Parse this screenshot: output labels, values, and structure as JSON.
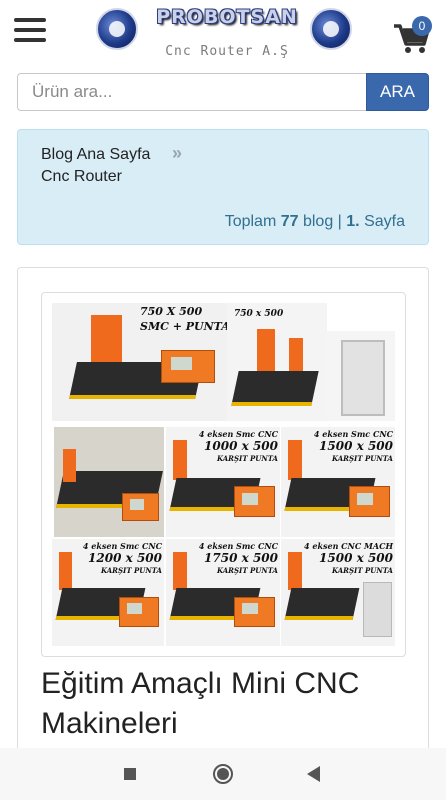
{
  "header": {
    "logo_title": "PROBOTSAN",
    "logo_subtitle": "Cnc Router A.Ş",
    "cart_count": "0"
  },
  "search": {
    "placeholder": "Ürün ara...",
    "button_label": "ARA"
  },
  "breadcrumb": {
    "home_label": "Blog Ana Sayfa",
    "separator": "»",
    "current_label": "Cnc Router",
    "total_prefix": "Toplam",
    "total_count": "77",
    "total_suffix": "blog",
    "divider": "|",
    "page_number": "1.",
    "page_label": "Sayfa"
  },
  "post": {
    "title": "Eğitim Amaçlı Mini CNC Makineleri",
    "image_labels": {
      "main_size": "750 X 500",
      "main_sub": "SMC + PUNTA",
      "side_size": "750 x 500",
      "t1_top": "4 eksen Smc CNC",
      "t1_size": "1000 x 500",
      "t1_sub": "KARŞIT PUNTA",
      "t2_top": "4 eksen Smc CNC",
      "t2_size": "1500 x 500",
      "t2_sub": "KARŞIT PUNTA",
      "t3_top": "4 eksen Smc CNC",
      "t3_size": "1200 x 500",
      "t3_sub": "KARŞIT PUNTA",
      "t4_top": "4 eksen Smc CNC",
      "t4_size": "1750 x 500",
      "t4_sub": "KARŞIT PUNTA",
      "t5_top": "4 eksen CNC MACH",
      "t5_size": "1500 x 500",
      "t5_sub": "KARŞIT PUNTA"
    }
  },
  "colors": {
    "accent": "#3a68ad",
    "breadcrumb_bg": "#d9edf7",
    "breadcrumb_text": "#31708f",
    "machine_orange": "#ef6a1c"
  },
  "icons": {
    "menu": "hamburger-menu-icon",
    "cart": "shopping-cart-icon",
    "breadcrumb_separator": "double-chevron-right-icon",
    "nav_recents": "square-icon",
    "nav_home": "circle-icon",
    "nav_back": "triangle-back-icon"
  }
}
